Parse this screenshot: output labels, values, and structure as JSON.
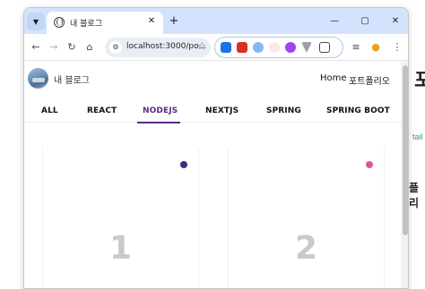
{
  "browser": {
    "tab_title": "내 블로그",
    "url": "localhost:3000/po...",
    "new_tab": "+",
    "close_tab": "✕",
    "minimize": "—",
    "maximize": "▢",
    "close": "✕"
  },
  "background_window": {
    "heading_char": "포",
    "link_text": "tail",
    "subheading": "플리"
  },
  "site": {
    "title": "내 블로그",
    "nav": [
      {
        "label": "Home"
      },
      {
        "label": "포트폴리오"
      }
    ]
  },
  "categories": [
    {
      "label": "ALL"
    },
    {
      "label": "REACT"
    },
    {
      "label": "NODEJS"
    },
    {
      "label": "NEXTJS"
    },
    {
      "label": "SPRING"
    },
    {
      "label": "SPRING BOOT"
    }
  ],
  "active_category": "NODEJS",
  "colors": {
    "accent": "#5b2c86",
    "dot_1": "#3b2f7a",
    "dot_2": "#e0539a"
  },
  "cards": [
    {
      "number": "1"
    },
    {
      "number": "2"
    }
  ]
}
